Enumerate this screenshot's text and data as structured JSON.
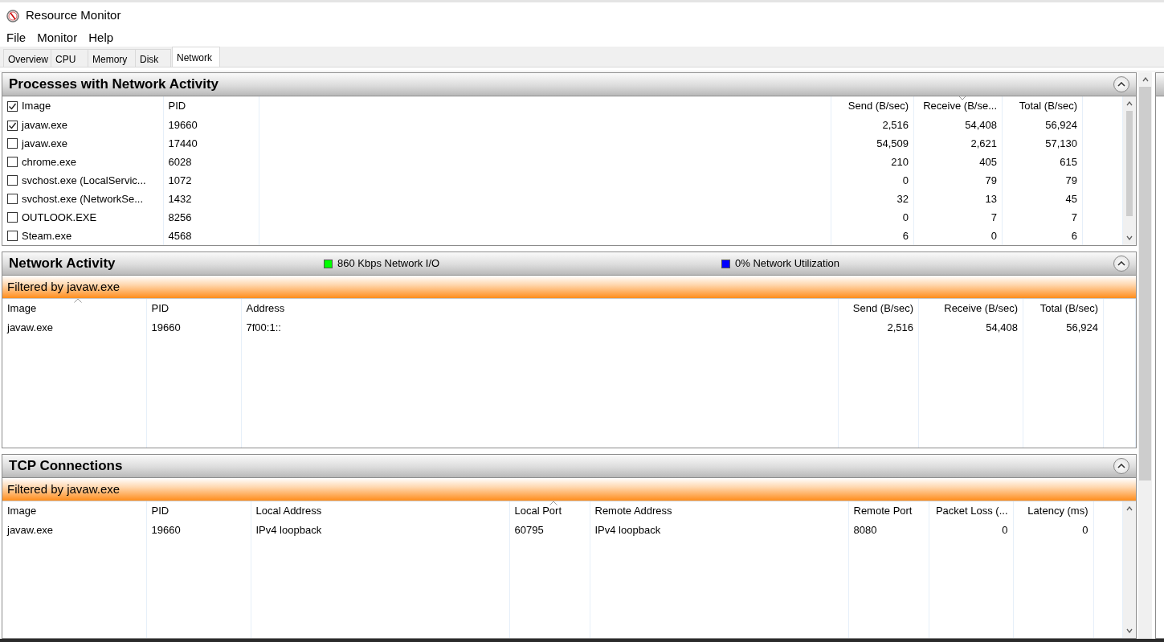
{
  "window": {
    "title": "Resource Monitor"
  },
  "menu": [
    "File",
    "Monitor",
    "Help"
  ],
  "tabs": [
    {
      "label": "Overview",
      "selected": false
    },
    {
      "label": "CPU",
      "selected": false
    },
    {
      "label": "Memory",
      "selected": false
    },
    {
      "label": "Disk",
      "selected": false
    },
    {
      "label": "Network",
      "selected": true
    }
  ],
  "processes": {
    "title": "Processes with Network Activity",
    "all_checked": true,
    "columns": [
      {
        "label": "Image",
        "sorted": false
      },
      {
        "label": "PID",
        "sorted": false
      },
      {
        "label": "Send (B/sec)",
        "sorted": false
      },
      {
        "label": "Receive (B/se...",
        "sorted": true,
        "descending": true
      },
      {
        "label": "Total (B/sec)",
        "sorted": false
      }
    ],
    "rows": [
      {
        "checked": true,
        "cells": [
          "javaw.exe",
          "19660",
          "2,516",
          "54,408",
          "56,924"
        ]
      },
      {
        "checked": false,
        "cells": [
          "javaw.exe",
          "17440",
          "54,509",
          "2,621",
          "57,130"
        ]
      },
      {
        "checked": false,
        "cells": [
          "chrome.exe",
          "6028",
          "210",
          "405",
          "615"
        ]
      },
      {
        "checked": false,
        "cells": [
          "svchost.exe (LocalServic...",
          "1072",
          "0",
          "79",
          "79"
        ]
      },
      {
        "checked": false,
        "cells": [
          "svchost.exe (NetworkSe...",
          "1432",
          "32",
          "13",
          "45"
        ]
      },
      {
        "checked": false,
        "cells": [
          "OUTLOOK.EXE",
          "8256",
          "0",
          "7",
          "7"
        ]
      },
      {
        "checked": false,
        "cells": [
          "Steam.exe",
          "4568",
          "6",
          "0",
          "6"
        ]
      }
    ]
  },
  "network_activity": {
    "title": "Network Activity",
    "indicators": [
      {
        "label": "860 Kbps Network I/O",
        "color": "#00ff00"
      },
      {
        "label": "0% Network Utilization",
        "color": "#0000ff"
      }
    ],
    "filter": "Filtered by javaw.exe",
    "columns": [
      {
        "label": "Image",
        "sorted": true,
        "descending": false
      },
      {
        "label": "PID",
        "sorted": false
      },
      {
        "label": "Address",
        "sorted": false
      },
      {
        "label": "Send (B/sec)",
        "sorted": false
      },
      {
        "label": "Receive (B/sec)",
        "sorted": false
      },
      {
        "label": "Total (B/sec)",
        "sorted": false
      }
    ],
    "rows": [
      {
        "cells": [
          "javaw.exe",
          "19660",
          "7f00:1::",
          "2,516",
          "54,408",
          "56,924"
        ]
      }
    ]
  },
  "tcp_connections": {
    "title": "TCP Connections",
    "filter": "Filtered by javaw.exe",
    "columns": [
      {
        "label": "Image",
        "sorted": false
      },
      {
        "label": "PID",
        "sorted": false
      },
      {
        "label": "Local Address",
        "sorted": false
      },
      {
        "label": "Local Port",
        "sorted": true,
        "descending": false
      },
      {
        "label": "Remote Address",
        "sorted": false
      },
      {
        "label": "Remote Port",
        "sorted": false
      },
      {
        "label": "Packet Loss (...",
        "sorted": false
      },
      {
        "label": "Latency (ms)",
        "sorted": false
      }
    ],
    "rows": [
      {
        "cells": [
          "javaw.exe",
          "19660",
          "IPv4 loopback",
          "60795",
          "IPv4 loopback",
          "8080",
          "0",
          "0"
        ]
      }
    ]
  }
}
